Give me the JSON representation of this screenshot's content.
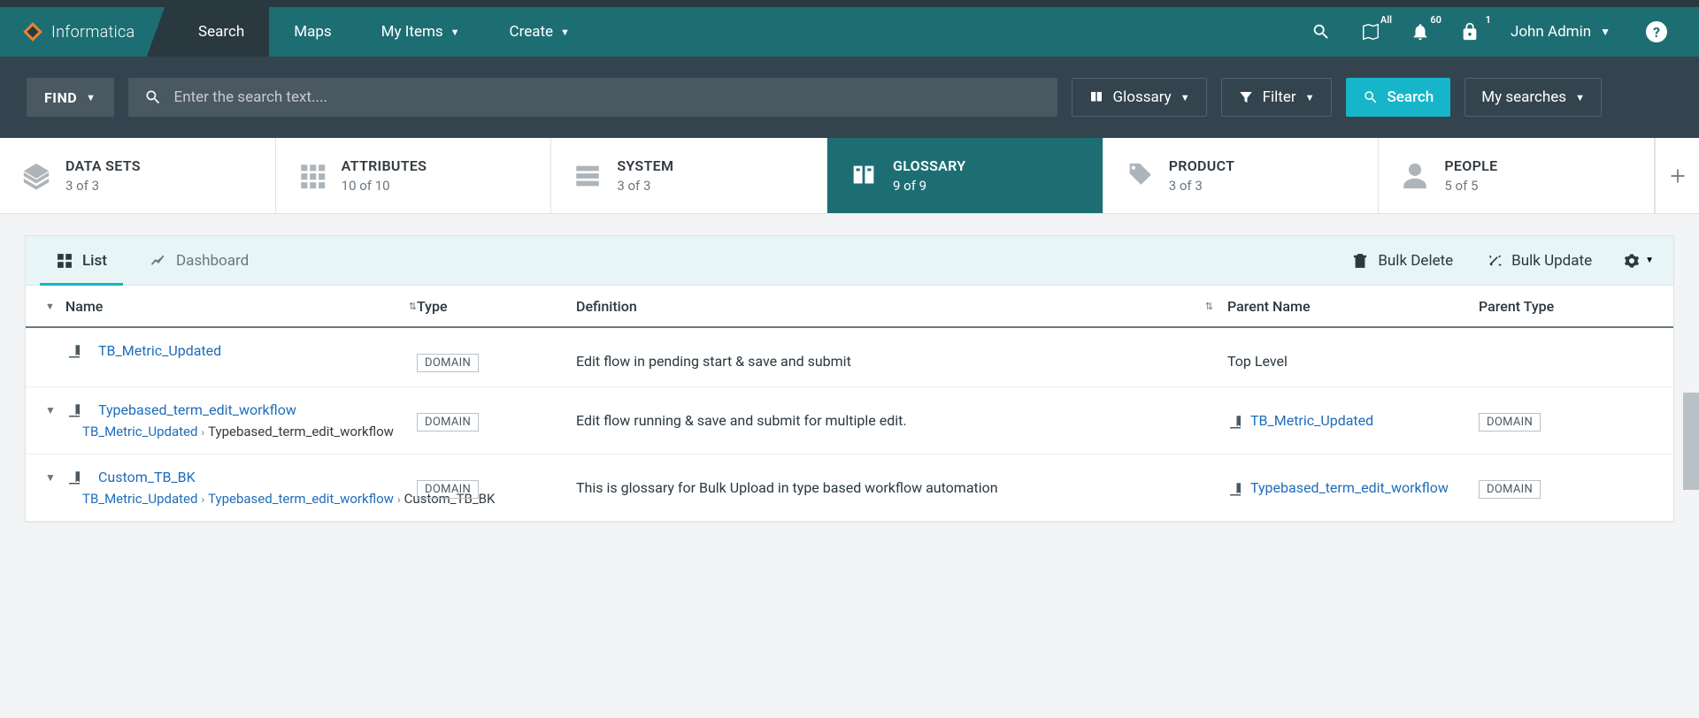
{
  "brand": "Informatica",
  "nav": [
    {
      "label": "Search",
      "active": true,
      "hasChev": false
    },
    {
      "label": "Maps",
      "active": false,
      "hasChev": false
    },
    {
      "label": "My Items",
      "active": false,
      "hasChev": true
    },
    {
      "label": "Create",
      "active": false,
      "hasChev": true
    }
  ],
  "header": {
    "mapBadge": "All",
    "bellBadge": "60",
    "lockBadge": "1",
    "user": "John Admin",
    "help": "?"
  },
  "searchbar": {
    "find": "FIND",
    "placeholder": "Enter the search text....",
    "glossary": "Glossary",
    "filter": "Filter",
    "search": "Search",
    "mySearches": "My searches"
  },
  "tabs": [
    {
      "label": "DATA SETS",
      "count": "3 of 3",
      "icon": "layers"
    },
    {
      "label": "ATTRIBUTES",
      "count": "10 of 10",
      "icon": "grid"
    },
    {
      "label": "SYSTEM",
      "count": "3 of 3",
      "icon": "server"
    },
    {
      "label": "GLOSSARY",
      "count": "9 of 9",
      "icon": "book"
    },
    {
      "label": "PRODUCT",
      "count": "3 of 3",
      "icon": "tag"
    },
    {
      "label": "PEOPLE",
      "count": "5 of 5",
      "icon": "person"
    }
  ],
  "activeTab": 3,
  "panel": {
    "listTab": "List",
    "dashboardTab": "Dashboard",
    "bulkDelete": "Bulk Delete",
    "bulkUpdate": "Bulk Update"
  },
  "columns": {
    "name": "Name",
    "type": "Type",
    "definition": "Definition",
    "parentName": "Parent Name",
    "parentType": "Parent Type"
  },
  "rows": [
    {
      "title": "TB_Metric_Updated",
      "type": "DOMAIN",
      "definition": "Edit flow in pending start & save and submit",
      "parentName": "Top Level",
      "parentLink": false,
      "parentType": "",
      "breadcrumbs": [],
      "hasExpand": false
    },
    {
      "title": "Typebased_term_edit_workflow",
      "type": "DOMAIN",
      "definition": "Edit flow running & save and submit for multiple edit.",
      "parentName": "TB_Metric_Updated",
      "parentLink": true,
      "parentType": "DOMAIN",
      "breadcrumbs": [
        {
          "text": "TB_Metric_Updated",
          "link": true
        },
        {
          "text": "Typebased_term_edit_workflow",
          "link": false
        }
      ],
      "hasExpand": true
    },
    {
      "title": "Custom_TB_BK",
      "type": "DOMAIN",
      "definition": "This is glossary for Bulk Upload in type based workflow automation",
      "parentName": "Typebased_term_edit_workflow",
      "parentLink": true,
      "parentType": "DOMAIN",
      "breadcrumbs": [
        {
          "text": "TB_Metric_Updated",
          "link": true
        },
        {
          "text": "Typebased_term_edit_workflow",
          "link": true
        },
        {
          "text": "Custom_TB_BK",
          "link": false
        }
      ],
      "hasExpand": true
    }
  ]
}
